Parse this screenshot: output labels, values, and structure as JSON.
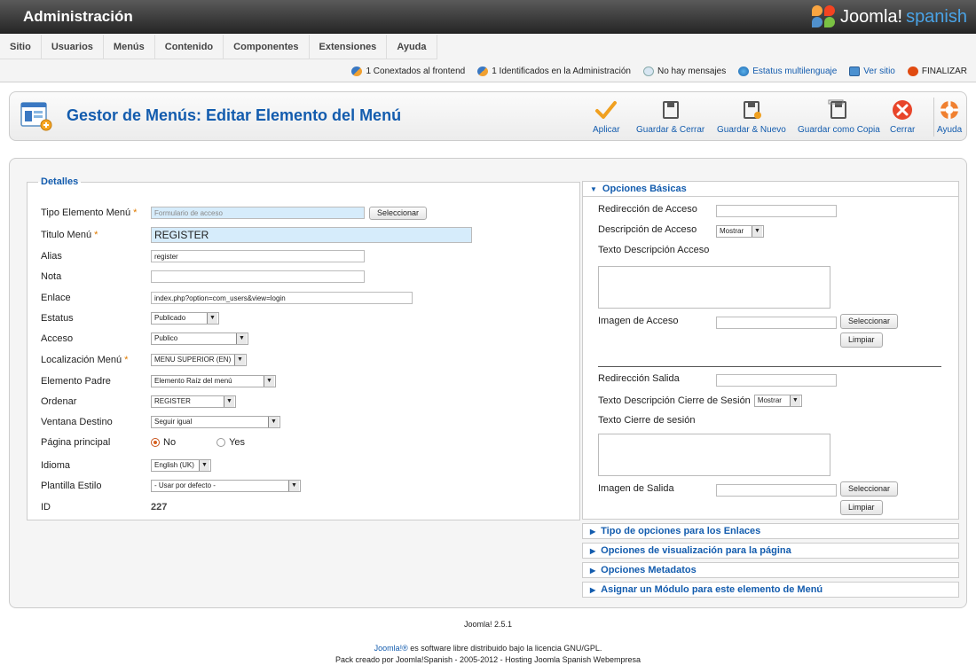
{
  "header": {
    "title": "Administración",
    "logo_text_1": "Joomla!",
    "logo_text_2": "spanish"
  },
  "menu": [
    "Sitio",
    "Usuarios",
    "Menús",
    "Contenido",
    "Componentes",
    "Extensiones",
    "Ayuda"
  ],
  "status": {
    "frontend": "1 Conextados al frontend",
    "admin": "1 Identificados en la Administración",
    "messages": "No hay mensajes",
    "multilang": "Estatus multilenguaje",
    "view_site": "Ver sitio",
    "logout": "FINALIZAR"
  },
  "toolbar": {
    "title": "Gestor de Menús: Editar Elemento del Menú",
    "apply": "Aplicar",
    "save_close": "Guardar & Cerrar",
    "save_new": "Guardar & Nuevo",
    "save_copy": "Guardar como Copia",
    "close": "Cerrar",
    "help": "Ayuda"
  },
  "details": {
    "legend": "Detalles",
    "menu_type_label": "Tipo Elemento Menú",
    "menu_type_value": "Formulario de acceso",
    "select_button": "Seleccionar",
    "title_label": "Titulo Menú",
    "title_value": "REGISTER",
    "alias_label": "Alias",
    "alias_value": "register",
    "note_label": "Nota",
    "note_value": "",
    "link_label": "Enlace",
    "link_value": "index.php?option=com_users&view=login",
    "status_label": "Estatus",
    "status_value": "Publicado",
    "access_label": "Acceso",
    "access_value": "Publico",
    "menu_location_label": "Localización Menú",
    "menu_location_value": "MENU SUPERIOR (EN)",
    "parent_label": "Elemento Padre",
    "parent_value": "Elemento Raíz del menú",
    "order_label": "Ordenar",
    "order_value": "REGISTER",
    "target_label": "Ventana Destino",
    "target_value": "Seguir igual",
    "home_label": "Página principal",
    "home_no": "No",
    "home_yes": "Yes",
    "language_label": "Idioma",
    "language_value": "English (UK)",
    "template_label": "Plantilla Estilo",
    "template_value": "- Usar por defecto -",
    "id_label": "ID",
    "id_value": "227"
  },
  "options": {
    "basic_title": "Opciones Básicas",
    "login_redirect": "Redirección de Acceso",
    "login_desc": "Descripción de Acceso",
    "show": "Mostrar",
    "login_desc_text": "Texto Descripción Acceso",
    "login_image": "Imagen de Acceso",
    "select": "Seleccionar",
    "clear": "Limpiar",
    "logout_redirect": "Redirección Salida",
    "logout_desc": "Texto Descripción Cierre de Sesión",
    "logout_text": "Texto Cierre de sesión",
    "logout_image": "Imagen de Salida",
    "link_type": "Tipo de opciones para los Enlaces",
    "page_display": "Opciones de visualización para la página",
    "metadata": "Opciones Metadatos",
    "module_assign": "Asignar un Módulo para este elemento de Menú"
  },
  "footer": {
    "version": "Joomla! 2.5.1",
    "license_link": "Joomla!®",
    "license_text": " es software libre distribuido bajo la licencia GNU/GPL.",
    "pack": "Pack creado por Joomla!Spanish - 2005-2012 - Hosting Joomla Spanish Webempresa"
  },
  "colors": {
    "accent": "#135cae",
    "required": "#e07b00",
    "header": "#333333"
  }
}
